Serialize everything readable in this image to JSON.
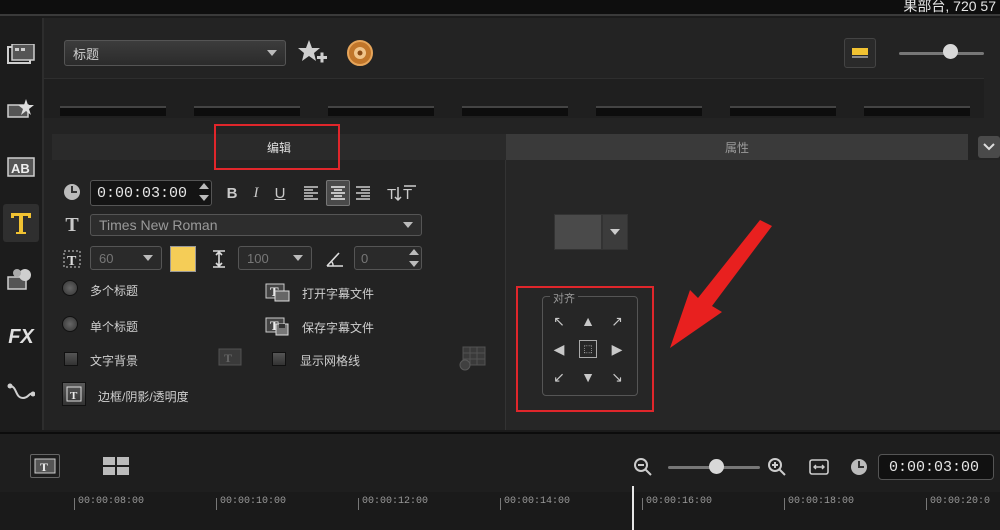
{
  "window": {
    "top_right_text": "果部台, 720 57"
  },
  "library": {
    "category": "标题",
    "timecode_slider": 0.6
  },
  "tabs": {
    "edit": "编辑",
    "properties": "属性"
  },
  "edit_panel": {
    "duration": "0:00:03:00",
    "format_buttons": [
      "B",
      "I",
      "U"
    ],
    "font": "Times New Roman",
    "font_size": "60",
    "font_color": "#f5cd57",
    "line_spacing": "100",
    "rotation": "0",
    "options": {
      "multi_title": "多个标题",
      "single_title": "单个标题",
      "text_background": "文字背景",
      "border_shadow": "边框/阴影/透明度",
      "open_subtitle": "打开字幕文件",
      "save_subtitle": "保存字幕文件",
      "show_grid": "显示网格线"
    }
  },
  "properties_panel": {
    "align_label": "对齐"
  },
  "timeline": {
    "timecode": "0:00:03:00",
    "zoom_level": 0.52,
    "ticks": [
      "00:00:08:00",
      "00:00:10:00",
      "00:00:12:00",
      "00:00:14:00",
      "00:00:16:00",
      "00:00:18:00",
      "00:00:20:0"
    ]
  },
  "colors": {
    "annotation_red": "#e0262b",
    "arrow_red": "#e8201f"
  }
}
